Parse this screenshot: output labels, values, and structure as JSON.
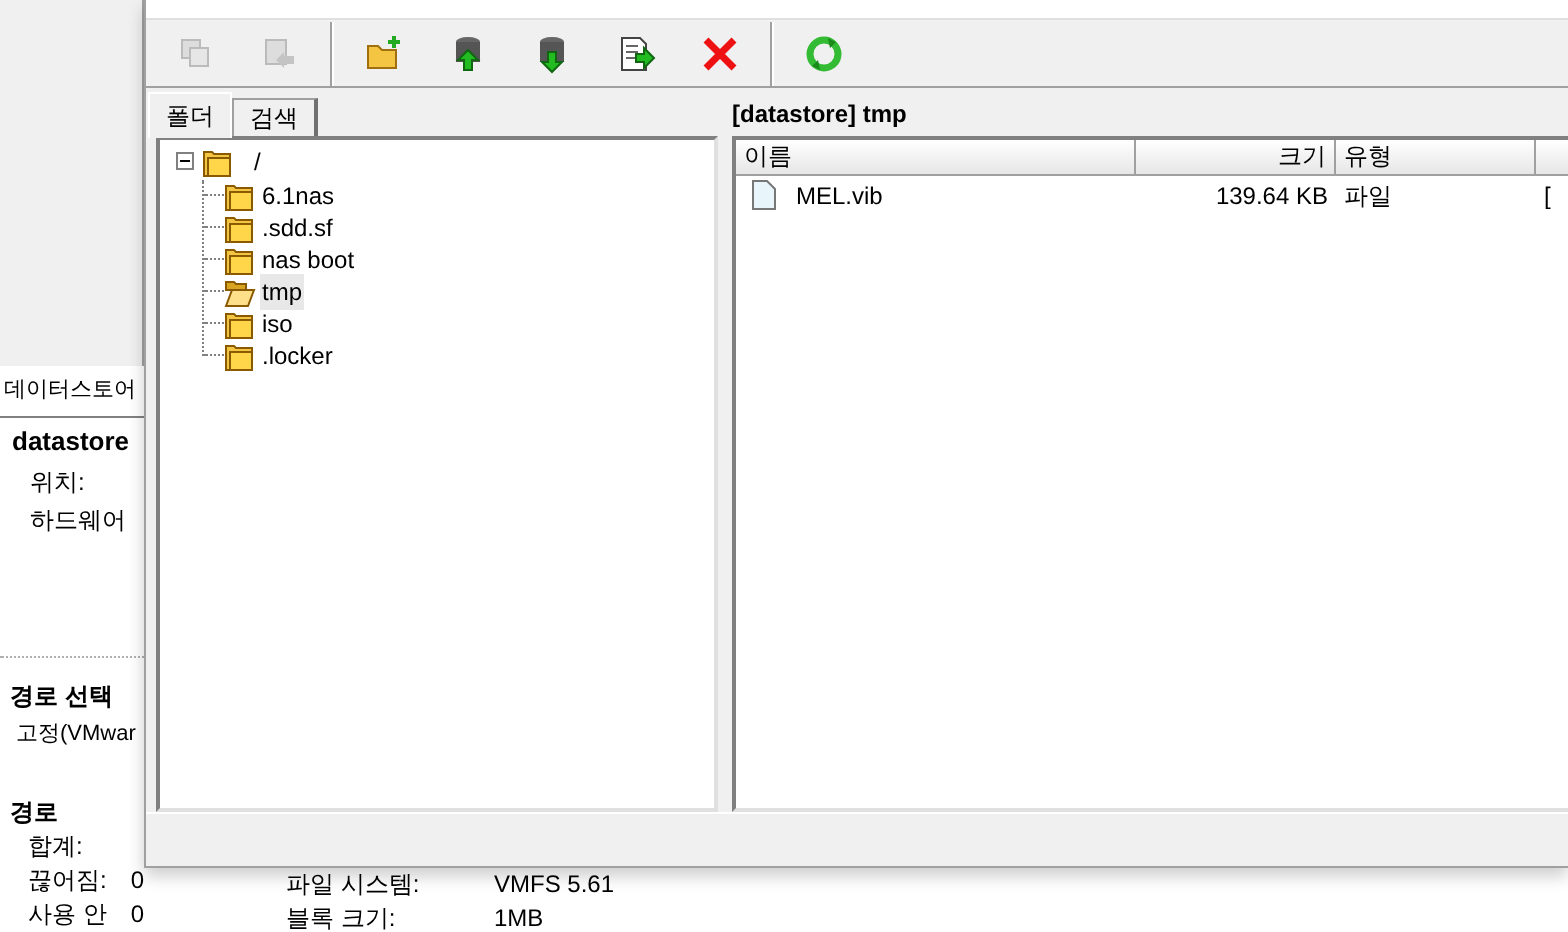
{
  "background_window": {
    "header": "데이터스토어",
    "name": "datastore",
    "fields": [
      "위치:",
      "하드웨어"
    ],
    "path_selection": {
      "title": "경로 선택",
      "value": "고정(VMwar"
    },
    "paths": {
      "title": "경로",
      "rows": [
        {
          "label": "합계:",
          "value": ""
        },
        {
          "label": "끊어짐:",
          "value": "0"
        },
        {
          "label": "사용 안",
          "value": "0"
        }
      ]
    },
    "properties": [
      {
        "label": "파일 시스템:",
        "value": "VMFS 5.61"
      },
      {
        "label": "블록 크기:",
        "value": "1MB"
      }
    ]
  },
  "dialog": {
    "toolbar": [
      {
        "kind": "copy",
        "disabled": true
      },
      {
        "kind": "move",
        "disabled": true
      },
      {
        "kind": "sep"
      },
      {
        "kind": "new-folder",
        "disabled": false
      },
      {
        "kind": "upload",
        "disabled": false
      },
      {
        "kind": "download",
        "disabled": false
      },
      {
        "kind": "export",
        "disabled": false
      },
      {
        "kind": "delete",
        "disabled": false
      },
      {
        "kind": "sep"
      },
      {
        "kind": "refresh",
        "disabled": false
      }
    ],
    "tabs": [
      {
        "label": "폴더",
        "selected": true
      },
      {
        "label": "검색",
        "selected": false
      }
    ],
    "tree": {
      "label": "/",
      "expanded": true,
      "children": [
        {
          "label": "6.1nas",
          "selected": false
        },
        {
          "label": ".sdd.sf",
          "selected": false
        },
        {
          "label": "nas boot",
          "selected": false
        },
        {
          "label": "tmp",
          "selected": true
        },
        {
          "label": "iso",
          "selected": false
        },
        {
          "label": ".locker",
          "selected": false
        }
      ]
    },
    "path": "[datastore] tmp",
    "table": {
      "columns": [
        "이름",
        "크기",
        "유형",
        ""
      ],
      "rows": [
        {
          "name": "MEL.vib",
          "size": "139.64 KB",
          "type": "파일",
          "column_4": "["
        }
      ]
    }
  }
}
